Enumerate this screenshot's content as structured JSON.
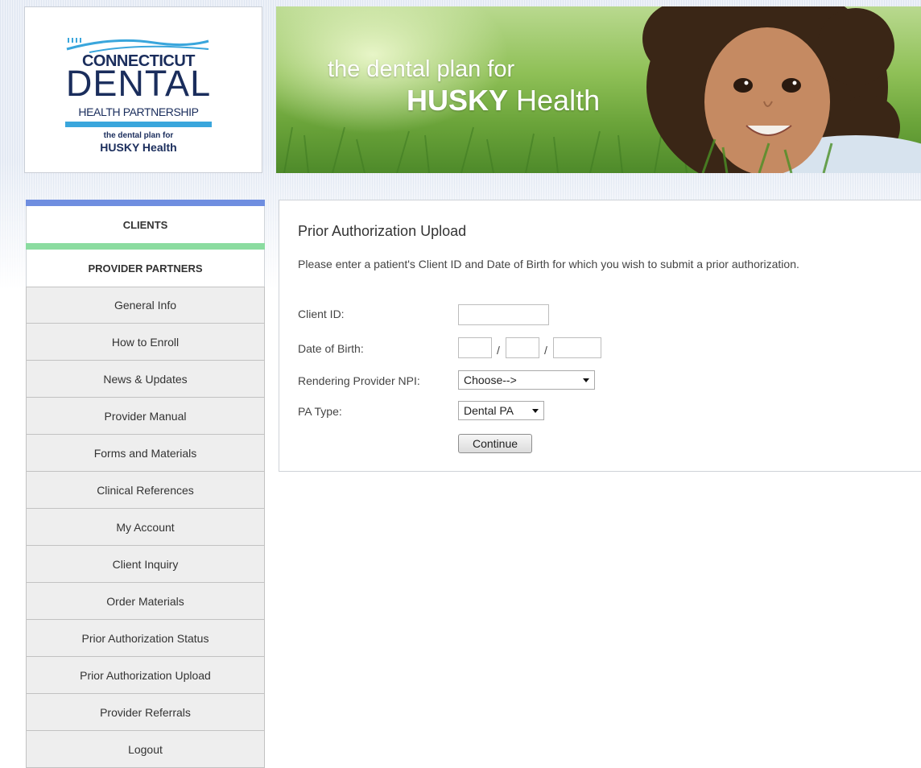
{
  "logo": {
    "line1": "CONNECTICUT",
    "line2": "DENTAL",
    "line3": "HEALTH PARTNERSHIP",
    "tagline": "the dental plan for",
    "brand": "HUSKY Health"
  },
  "banner": {
    "line1": "the dental plan for",
    "line2_strong": "HUSKY",
    "line2_rest": " Health"
  },
  "colors": {
    "clients_stripe": "#6f8ee0",
    "provider_stripe": "#8bdca0",
    "brand_navy": "#1a2d5c",
    "brand_blue": "#3aa6dc"
  },
  "sidebar": {
    "clients_label": "CLIENTS",
    "provider_partners_label": "PROVIDER PARTNERS",
    "items": [
      "General Info",
      "How to Enroll",
      "News & Updates",
      "Provider Manual",
      "Forms and Materials",
      "Clinical References",
      "My Account",
      "Client Inquiry",
      "Order Materials",
      "Prior Authorization Status",
      "Prior Authorization Upload",
      "Provider Referrals",
      "Logout"
    ]
  },
  "main": {
    "title": "Prior Authorization Upload",
    "instructions": "Please enter a patient's Client ID and Date of Birth for which you wish to submit a prior authorization.",
    "form": {
      "client_id_label": "Client ID:",
      "client_id_value": "",
      "dob_label": "Date of Birth:",
      "dob_separator": "/",
      "npi_label": "Rendering Provider NPI:",
      "npi_selected": "Choose-->",
      "pa_type_label": "PA Type:",
      "pa_type_selected": "Dental PA",
      "continue_label": "Continue"
    }
  }
}
